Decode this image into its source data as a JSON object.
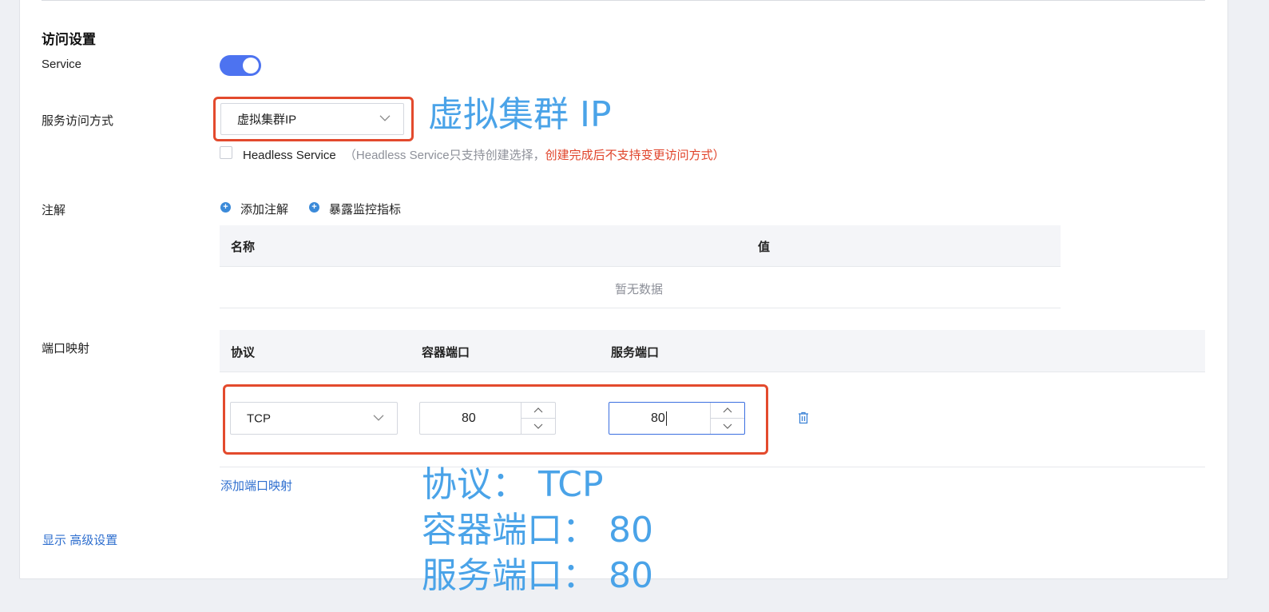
{
  "section": {
    "title": "访问设置"
  },
  "service": {
    "label": "Service",
    "enabled": true
  },
  "access": {
    "label": "服务访问方式",
    "selected": "虚拟集群IP",
    "headless_label": "Headless Service",
    "headless_note_gray": "（Headless Service只支持创建选择，",
    "headless_note_red": "创建完成后不支持变更访问方式）"
  },
  "annotations": {
    "label": "注解",
    "add_annotation": "添加注解",
    "expose_metrics": "暴露监控指标",
    "columns": [
      "名称",
      "值"
    ],
    "empty_text": "暂无数据"
  },
  "ports": {
    "label": "端口映射",
    "columns": [
      "协议",
      "容器端口",
      "服务端口"
    ],
    "rows": [
      {
        "protocol": "TCP",
        "container_port": "80",
        "service_port": "80"
      }
    ],
    "add_link": "添加端口映射"
  },
  "advanced": {
    "show": "显示",
    "label": "高级设置"
  },
  "overlay": {
    "access_note": "虚拟集群 IP",
    "line1": "协议： TCP",
    "line2": "容器端口： 80",
    "line3": "服务端口： 80"
  },
  "colors": {
    "accent": "#4d73f0",
    "highlight": "#e34a2d",
    "annotation_text": "#4aa3e8",
    "link": "#2f6fcf"
  }
}
